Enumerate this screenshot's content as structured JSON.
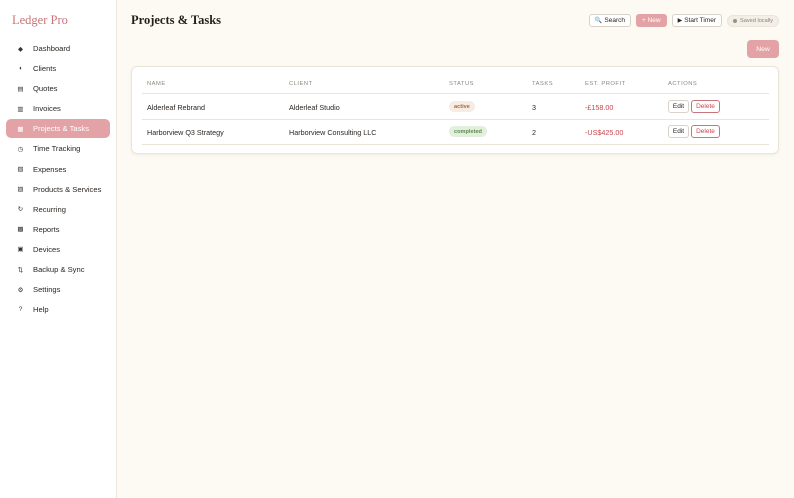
{
  "app": {
    "brand": "Ledger Pro"
  },
  "sidebar": {
    "items": [
      {
        "icon": "◆",
        "icon_name": "dashboard-icon",
        "label": "Dashboard"
      },
      {
        "icon": "◖",
        "icon_name": "clients-icon",
        "label": "Clients"
      },
      {
        "icon": "▤",
        "icon_name": "quotes-icon",
        "label": "Quotes"
      },
      {
        "icon": "▥",
        "icon_name": "invoices-icon",
        "label": "Invoices"
      },
      {
        "icon": "▦",
        "icon_name": "projects-icon",
        "label": "Projects & Tasks",
        "active": true
      },
      {
        "icon": "◷",
        "icon_name": "clock-icon",
        "label": "Time Tracking"
      },
      {
        "icon": "▧",
        "icon_name": "expenses-icon",
        "label": "Expenses"
      },
      {
        "icon": "▨",
        "icon_name": "products-icon",
        "label": "Products & Services"
      },
      {
        "icon": "↻",
        "icon_name": "recurring-icon",
        "label": "Recurring"
      },
      {
        "icon": "▩",
        "icon_name": "reports-icon",
        "label": "Reports"
      },
      {
        "icon": "▣",
        "icon_name": "devices-icon",
        "label": "Devices"
      },
      {
        "icon": "⇅",
        "icon_name": "sync-icon",
        "label": "Backup & Sync"
      },
      {
        "icon": "⚙",
        "icon_name": "gear-icon",
        "label": "Settings"
      },
      {
        "icon": "?",
        "icon_name": "help-icon",
        "label": "Help"
      }
    ]
  },
  "header": {
    "title": "Projects & Tasks",
    "search_icon": "🔍",
    "search_label": "Search",
    "new_label": "+ New",
    "timer_icon": "▶",
    "timer_label": "Start Timer",
    "saved_label": "Saved locally"
  },
  "main": {
    "new_button": "New",
    "table": {
      "columns": [
        "NAME",
        "CLIENT",
        "STATUS",
        "TASKS",
        "EST. PROFIT",
        "ACTIONS"
      ],
      "rows": [
        {
          "name": "Alderleaf Rebrand",
          "client": "Alderleaf Studio",
          "status": "active",
          "tasks": "3",
          "profit": "-£158.00"
        },
        {
          "name": "Harborview Q3 Strategy",
          "client": "Harborview Consulting LLC",
          "status": "completed",
          "tasks": "2",
          "profit": "-US$425.00"
        }
      ],
      "edit_label": "Edit",
      "delete_label": "Delete"
    }
  },
  "colors": {
    "accent": "#e3a3a6",
    "brand": "#c9747a",
    "negative": "#c9474f",
    "background": "#fdfaf3"
  }
}
